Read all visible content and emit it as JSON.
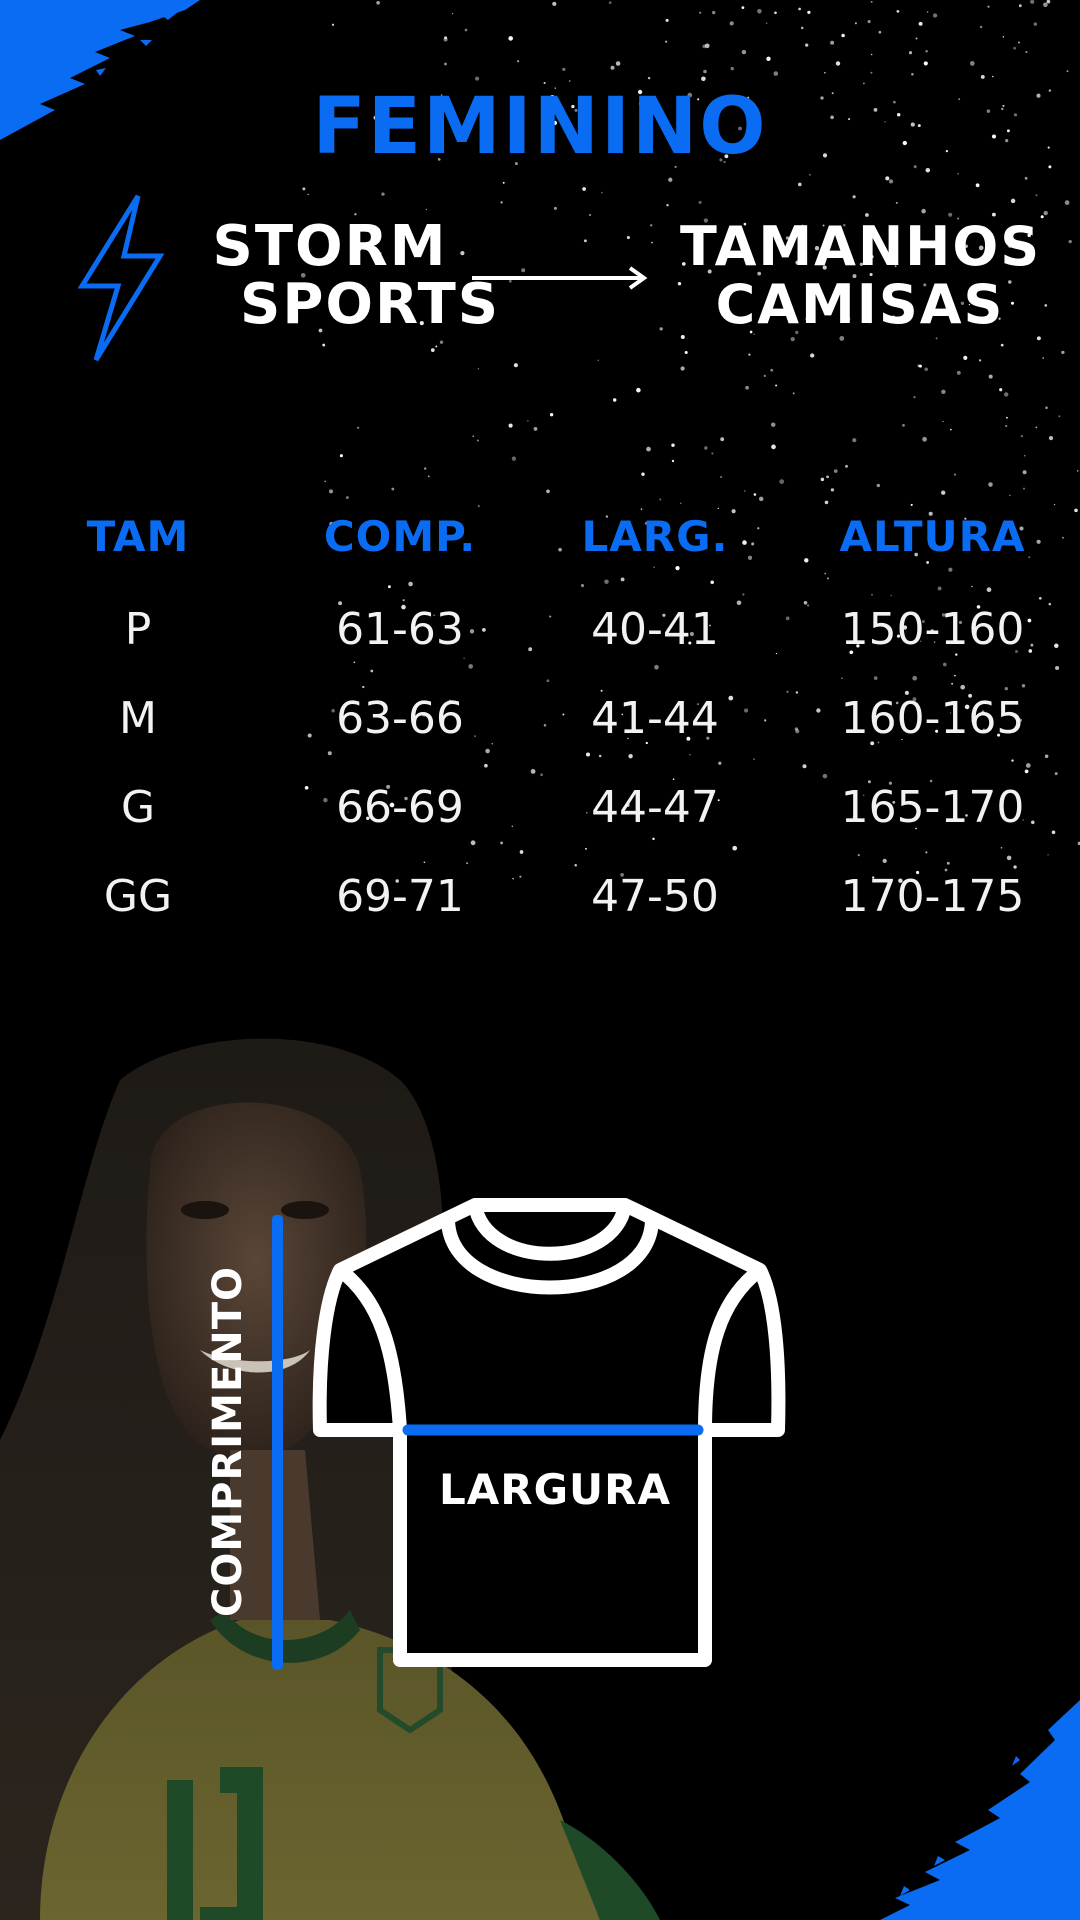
{
  "header": {
    "title": "FEMININO",
    "brand_line1": "STORM",
    "brand_line2": "SPORTS",
    "sizes_line1": "TAMANHOS",
    "sizes_line2": "CAMISAS"
  },
  "table": {
    "columns": [
      "TAM",
      "COMP.",
      "LARG.",
      "ALTURA"
    ],
    "rows": [
      [
        "P",
        "61-63",
        "40-41",
        "150-160"
      ],
      [
        "M",
        "63-66",
        "41-44",
        "160-165"
      ],
      [
        "G",
        "66-69",
        "44-47",
        "165-170"
      ],
      [
        "GG",
        "69-71",
        "47-50",
        "170-175"
      ]
    ]
  },
  "diagram": {
    "length_label": "COMPRIMENTO",
    "width_label": "LARGURA"
  },
  "colors": {
    "accent": "#0a6cf2",
    "background": "#000000",
    "text": "#ffffff"
  },
  "icons": [
    "lightning-bolt-icon",
    "arrow-right-icon",
    "tshirt-icon"
  ]
}
